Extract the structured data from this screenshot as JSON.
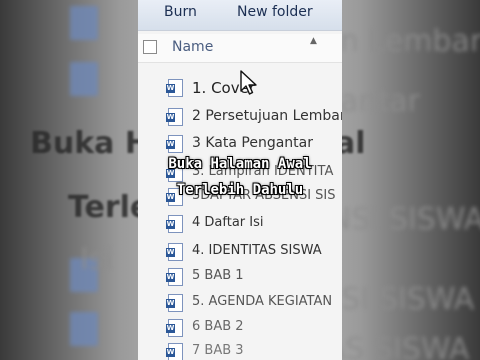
{
  "toolbar": {
    "burn_label": "Burn",
    "new_folder_label": "New folder"
  },
  "list_header": {
    "name_label": "Name"
  },
  "files": [
    {
      "name": "1. Cover"
    },
    {
      "name": "2 Persetujuan Lembar"
    },
    {
      "name": "3 Kata Pengantar"
    },
    {
      "name": "3. Lampiran IDENTITA"
    },
    {
      "name": "3DAFTAR ABSENSI SIS"
    },
    {
      "name": "4 Daftar Isi"
    },
    {
      "name": "4. IDENTITAS SISWA"
    },
    {
      "name": "5 BAB 1"
    },
    {
      "name": "5. AGENDA KEGIATAN"
    },
    {
      "name": "6 BAB 2"
    },
    {
      "name": "7 BAB 3"
    }
  ],
  "background_text": {
    "rows": [
      "n Lembar",
      "antar",
      "Buka Halaman Awal",
      "Terlebih Dahulu",
      "ENSI SISWA",
      "Isi",
      "ENSI SISWA",
      "ITAS SISWA"
    ]
  },
  "caption": {
    "line1": "Buka Halaman Awal",
    "line2": "Terlebih Dahulu"
  },
  "colors": {
    "word_blue": "#2b5797",
    "caption_text": "#ffffff",
    "caption_outline": "#000000"
  }
}
